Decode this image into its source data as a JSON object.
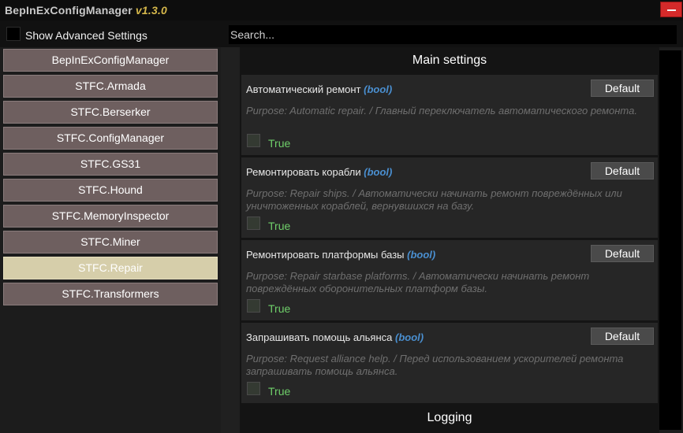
{
  "window": {
    "title": "BepInExConfigManager",
    "version": "v1.3.0"
  },
  "toolbar": {
    "show_advanced_label": "Show Advanced Settings",
    "show_advanced_checked": false,
    "search_placeholder": "Search...",
    "search_value": ""
  },
  "sidebar": {
    "items": [
      {
        "label": "BepInExConfigManager",
        "active": false
      },
      {
        "label": "STFC.Armada",
        "active": false
      },
      {
        "label": "STFC.Berserker",
        "active": false
      },
      {
        "label": "STFC.ConfigManager",
        "active": false
      },
      {
        "label": "STFC.GS31",
        "active": false
      },
      {
        "label": "STFC.Hound",
        "active": false
      },
      {
        "label": "STFC.MemoryInspector",
        "active": false
      },
      {
        "label": "STFC.Miner",
        "active": false
      },
      {
        "label": "STFC.Repair",
        "active": true
      },
      {
        "label": "STFC.Transformers",
        "active": false
      }
    ]
  },
  "main": {
    "sections": [
      {
        "title": "Main settings"
      },
      {
        "title": "Logging"
      }
    ],
    "entries": [
      {
        "name": "Автоматический ремонт",
        "type": "(bool)",
        "default_label": "Default",
        "description": "Purpose: Automatic repair. / Главный переключатель автоматического ремонта.",
        "value": "True"
      },
      {
        "name": "Ремонтировать корабли",
        "type": "(bool)",
        "default_label": "Default",
        "description": "Purpose: Repair ships. / Автоматически начинать ремонт повреждённых или уничтоженных кораблей, вернувшихся на базу.",
        "value": "True"
      },
      {
        "name": "Ремонтировать платформы базы",
        "type": "(bool)",
        "default_label": "Default",
        "description": "Purpose: Repair starbase platforms. / Автоматически начинать ремонт повреждённых оборонительных платформ базы.",
        "value": "True"
      },
      {
        "name": "Запрашивать помощь альянса",
        "type": "(bool)",
        "default_label": "Default",
        "description": "Purpose: Request alliance help. / Перед использованием ускорителей ремонта запрашивать помощь альянса.",
        "value": "True"
      }
    ]
  },
  "colors": {
    "active_item": "#d6ceaa",
    "inactive_item": "#6e5f5f",
    "type_accent": "#4a8fd0",
    "value_true": "#6fcf6a",
    "version_accent": "#d4b64a",
    "close_button": "#d42a2a"
  }
}
